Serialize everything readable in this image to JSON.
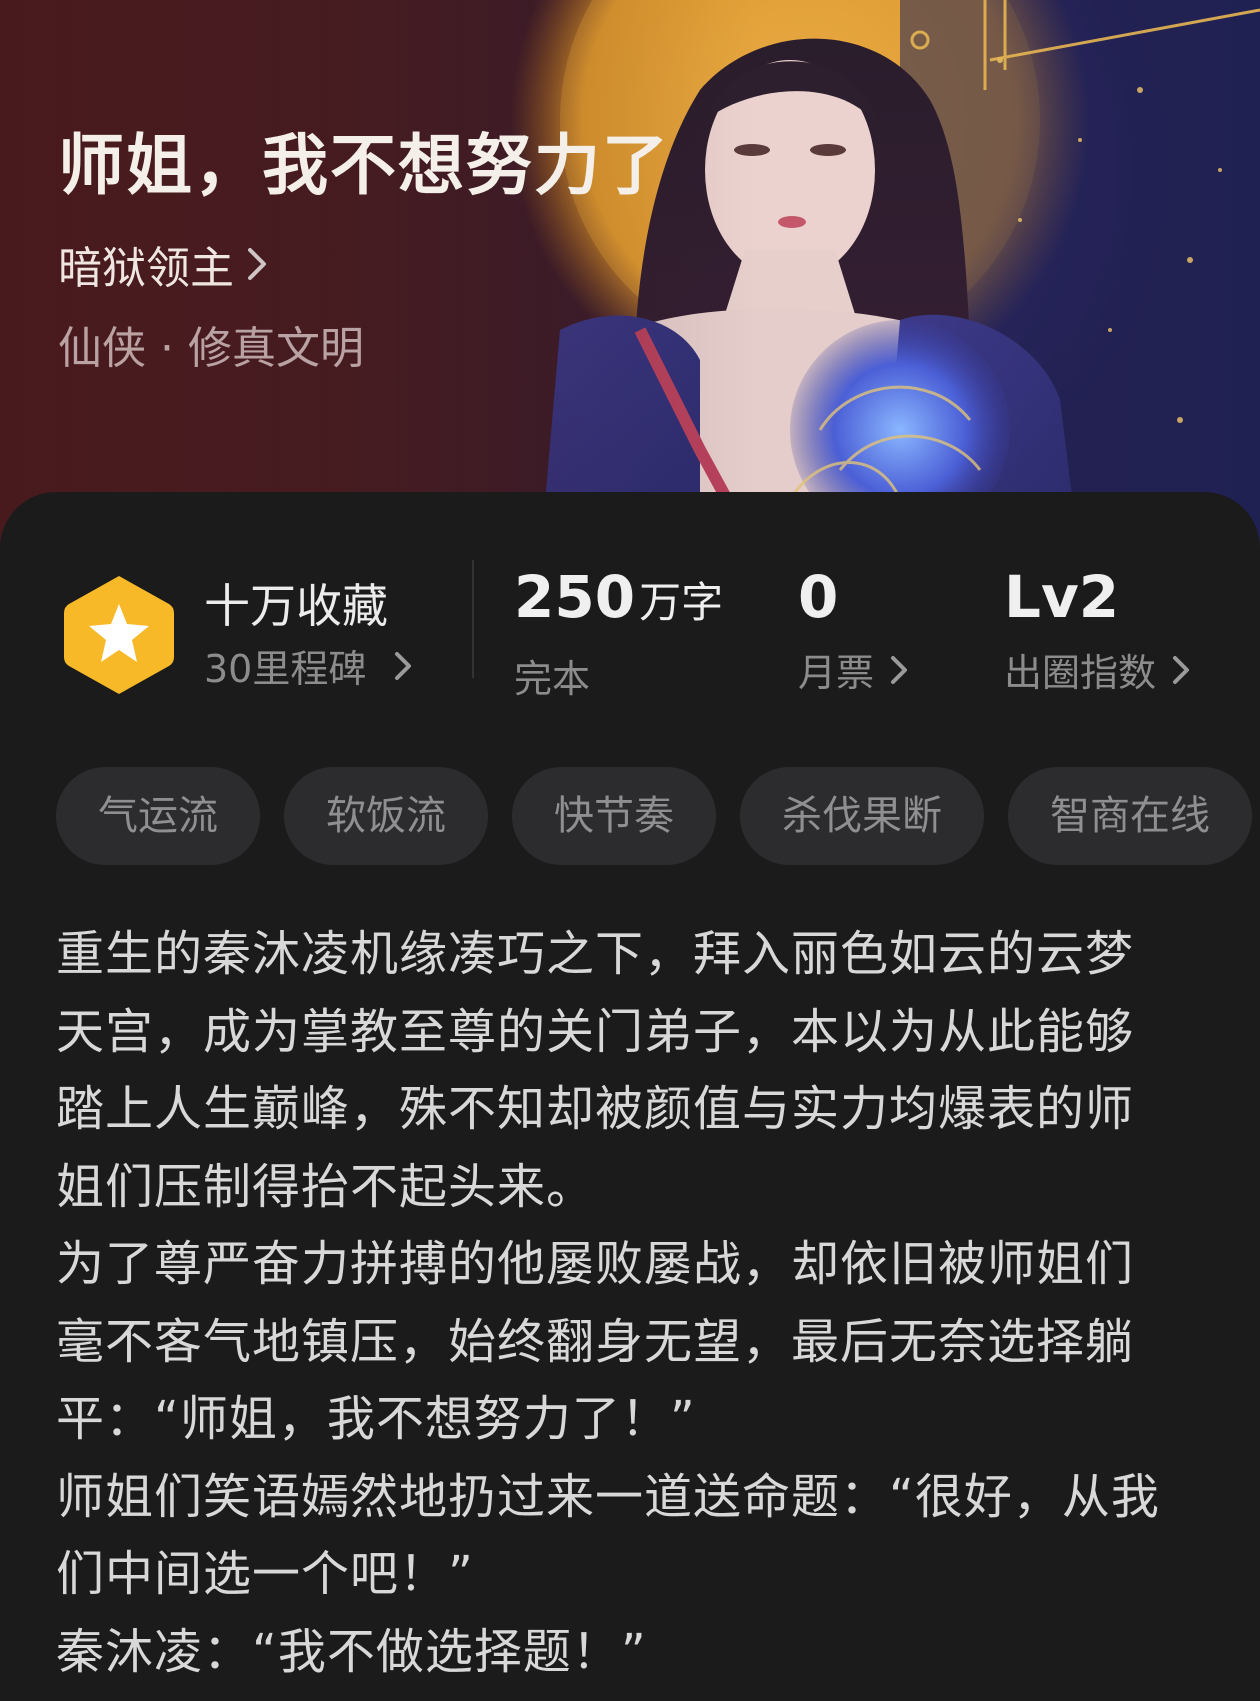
{
  "book": {
    "title": "师姐，我不想努力了",
    "author": "暗狱领主",
    "category": "仙侠 · 修真文明"
  },
  "stats": {
    "collect_title": "十万收藏",
    "collect_sub": "30里程碑",
    "words_value": "250",
    "words_unit": "万字",
    "words_label": "完本",
    "ticket_value": "0",
    "ticket_label": "月票",
    "level_value": "Lv2",
    "level_label": "出圈指数"
  },
  "tags": [
    "气运流",
    "软饭流",
    "快节奏",
    "杀伐果断",
    "智商在线"
  ],
  "synopsis": [
    "重生的秦沐凌机缘凑巧之下，拜入丽色如云的云梦天宫，成为掌教至尊的关门弟子，本以为从此能够踏上人生巅峰，殊不知却被颜值与实力均爆表的师姐们压制得抬不起头来。",
    "为了尊严奋力拼搏的他屡败屡战，却依旧被师姐们毫不客气地镇压，始终翻身无望，最后无奈选择躺平：“师姐，我不想努力了！”",
    "师姐们笑语嫣然地扔过来一道送命题：“很好，从我们中间选一个吧！”",
    "秦沐凌：“我不做选择题！”"
  ],
  "colors": {
    "background": "#1b1b1c",
    "tag_bg": "#2c2c2e",
    "badge_gold": "#f7b928",
    "muted_text": "#8c8c8c"
  },
  "icons": {
    "author_chevron": "chevron-right-icon",
    "badge": "star-hexagon-icon"
  }
}
